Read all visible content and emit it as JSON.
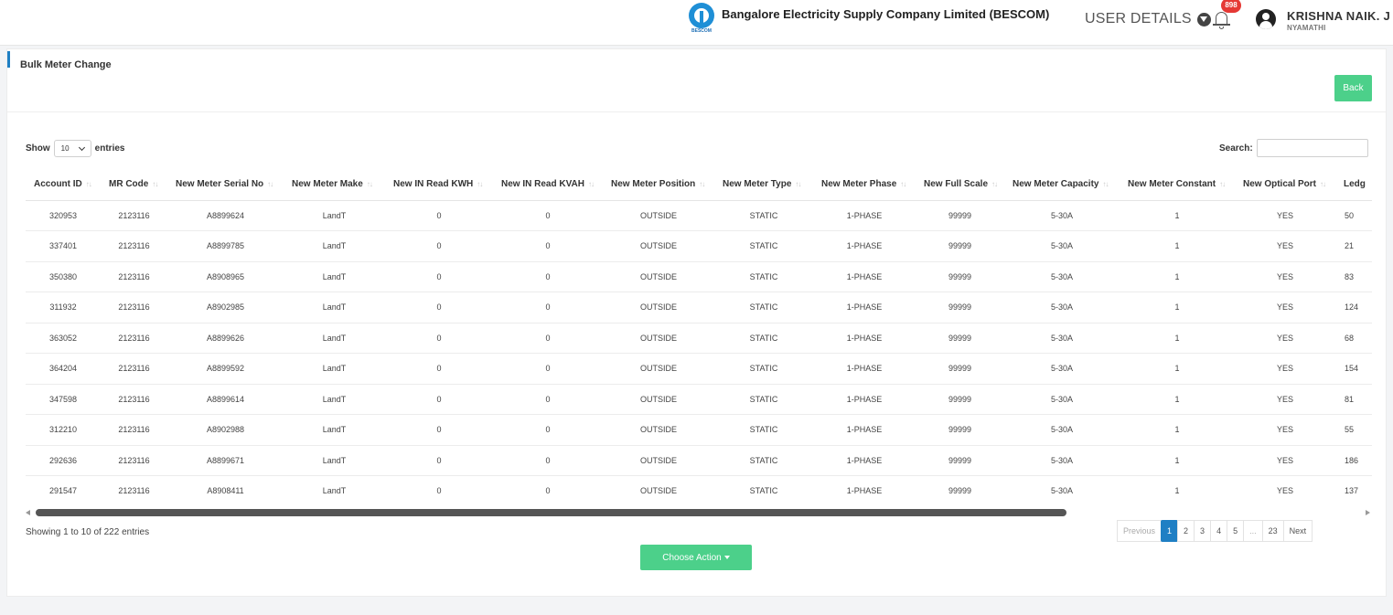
{
  "header": {
    "brand_name": "Bangalore Electricity Supply Company Limited (BESCOM)",
    "brand_logo_text": "BESCOM",
    "user_details_label": "USER DETAILS",
    "notification_count": "898",
    "user_name": "KRISHNA NAIK. J",
    "user_location": "NYAMATHI"
  },
  "page": {
    "title": "Bulk Meter Change",
    "back_label": "Back"
  },
  "table_controls": {
    "show_label": "Show",
    "entries_value": "10",
    "entries_label": "entries",
    "search_label": "Search:",
    "search_value": ""
  },
  "table": {
    "columns": [
      "Account ID",
      "MR Code",
      "New Meter Serial No",
      "New Meter Make",
      "New IN Read KWH",
      "New IN Read KVAH",
      "New Meter Position",
      "New Meter Type",
      "New Meter Phase",
      "New Full Scale",
      "New Meter Capacity",
      "New Meter Constant",
      "New Optical Port",
      "Ledg"
    ],
    "rows": [
      [
        "320953",
        "2123116",
        "A8899624",
        "LandT",
        "0",
        "0",
        "OUTSIDE",
        "STATIC",
        "1-PHASE",
        "99999",
        "5-30A",
        "1",
        "YES",
        "50"
      ],
      [
        "337401",
        "2123116",
        "A8899785",
        "LandT",
        "0",
        "0",
        "OUTSIDE",
        "STATIC",
        "1-PHASE",
        "99999",
        "5-30A",
        "1",
        "YES",
        "21"
      ],
      [
        "350380",
        "2123116",
        "A8908965",
        "LandT",
        "0",
        "0",
        "OUTSIDE",
        "STATIC",
        "1-PHASE",
        "99999",
        "5-30A",
        "1",
        "YES",
        "83"
      ],
      [
        "311932",
        "2123116",
        "A8902985",
        "LandT",
        "0",
        "0",
        "OUTSIDE",
        "STATIC",
        "1-PHASE",
        "99999",
        "5-30A",
        "1",
        "YES",
        "124"
      ],
      [
        "363052",
        "2123116",
        "A8899626",
        "LandT",
        "0",
        "0",
        "OUTSIDE",
        "STATIC",
        "1-PHASE",
        "99999",
        "5-30A",
        "1",
        "YES",
        "68"
      ],
      [
        "364204",
        "2123116",
        "A8899592",
        "LandT",
        "0",
        "0",
        "OUTSIDE",
        "STATIC",
        "1-PHASE",
        "99999",
        "5-30A",
        "1",
        "YES",
        "154"
      ],
      [
        "347598",
        "2123116",
        "A8899614",
        "LandT",
        "0",
        "0",
        "OUTSIDE",
        "STATIC",
        "1-PHASE",
        "99999",
        "5-30A",
        "1",
        "YES",
        "81"
      ],
      [
        "312210",
        "2123116",
        "A8902988",
        "LandT",
        "0",
        "0",
        "OUTSIDE",
        "STATIC",
        "1-PHASE",
        "99999",
        "5-30A",
        "1",
        "YES",
        "55"
      ],
      [
        "292636",
        "2123116",
        "A8899671",
        "LandT",
        "0",
        "0",
        "OUTSIDE",
        "STATIC",
        "1-PHASE",
        "99999",
        "5-30A",
        "1",
        "YES",
        "186"
      ],
      [
        "291547",
        "2123116",
        "A8908411",
        "LandT",
        "0",
        "0",
        "OUTSIDE",
        "STATIC",
        "1-PHASE",
        "99999",
        "5-30A",
        "1",
        "YES",
        "137"
      ]
    ]
  },
  "footer": {
    "info": "Showing 1 to 10 of 222 entries",
    "pagination": [
      "Previous",
      "1",
      "2",
      "3",
      "4",
      "5",
      "...",
      "23",
      "Next"
    ],
    "active_page": "1",
    "choose_action_label": "Choose Action"
  },
  "colors": {
    "accent_green": "#4cd08a",
    "accent_blue": "#1f7fc4",
    "badge_red": "#e53935"
  },
  "icons": [
    "bescom-logo-icon",
    "chevron-circle-down-icon",
    "bell-icon",
    "user-circle-icon",
    "sort-icon",
    "chevron-down-icon",
    "caret-down-icon",
    "scroll-left-icon",
    "scroll-right-icon"
  ]
}
